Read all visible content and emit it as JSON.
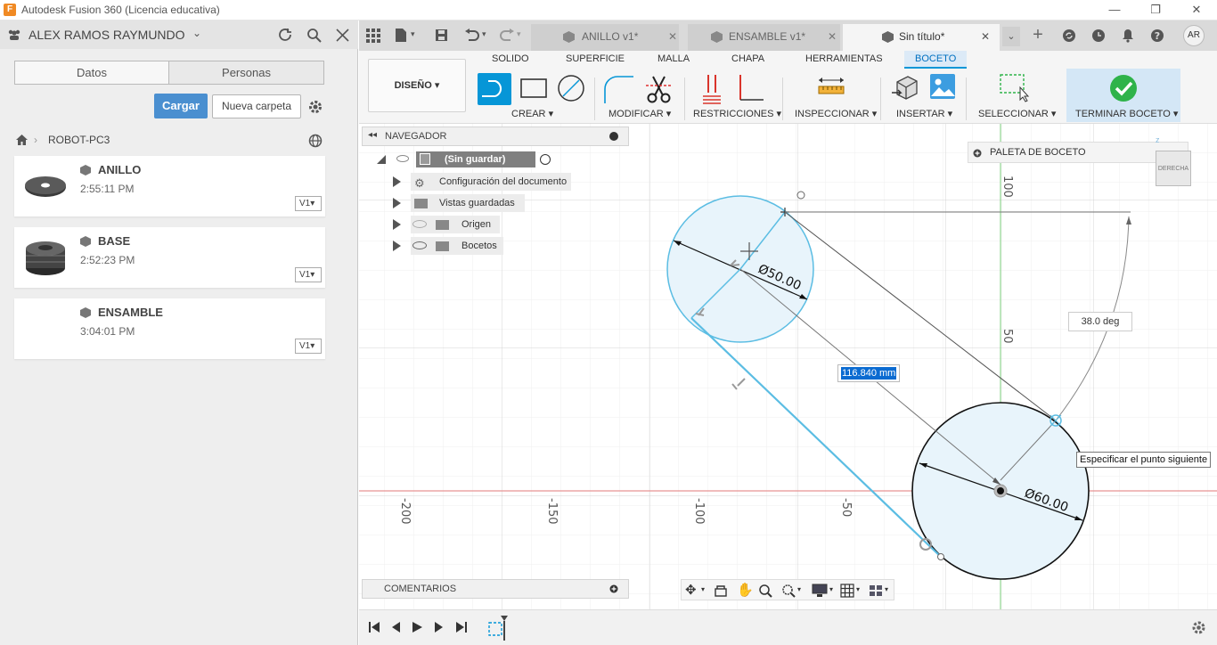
{
  "window": {
    "title": "Autodesk Fusion 360 (Licencia educativa)",
    "app_icon_letter": "F"
  },
  "left_panel": {
    "user": "ALEX RAMOS RAYMUNDO",
    "tabs": [
      "Datos",
      "Personas"
    ],
    "upload_button": "Cargar",
    "new_folder_button": "Nueva carpeta",
    "breadcrumb": "ROBOT-PC3",
    "files": [
      {
        "name": "ANILLO",
        "time": "2:55:11 PM",
        "version": "V1"
      },
      {
        "name": "BASE",
        "time": "2:52:23 PM",
        "version": "V1"
      },
      {
        "name": "ENSAMBLE",
        "time": "3:04:01 PM",
        "version": "V1"
      }
    ]
  },
  "doc_tabs": [
    {
      "label": "ANILLO v1*",
      "active": false
    },
    {
      "label": "ENSAMBLE v1*",
      "active": false
    },
    {
      "label": "Sin título*",
      "active": true
    }
  ],
  "user_initials": "AR",
  "ribbon": {
    "workspace": "DISEÑO",
    "tabs": [
      "SOLIDO",
      "SUPERFICIE",
      "MALLA",
      "CHAPA",
      "HERRAMIENTAS",
      "BOCETO"
    ],
    "active_tab": "BOCETO",
    "groups": [
      "CREAR",
      "MODIFICAR",
      "RESTRICCIONES",
      "INSPECCIONAR",
      "INSERTAR",
      "SELECCIONAR",
      "TERMINAR BOCETO"
    ]
  },
  "navigator": {
    "title": "NAVEGADOR",
    "root": "(Sin guardar)",
    "items": [
      "Configuración del documento",
      "Vistas guardadas",
      "Origen",
      "Bocetos"
    ]
  },
  "sketch_palette": "PALETA DE BOCETO",
  "viewcube_label": "DERECHA",
  "comments": "COMENTARIOS",
  "sketch": {
    "dim_circle1": "Ø50.00",
    "dim_circle2": "Ø60.00",
    "length_input": "116.840 mm",
    "angle": "38.0 deg",
    "tooltip": "Especificar el punto siguiente",
    "axis_labels_x": [
      "-200",
      "-150",
      "-100",
      "-50"
    ],
    "axis_labels_y": [
      "100",
      "50"
    ]
  },
  "colors": {
    "accent": "#0696d7",
    "sketch_blue": "#5bbde3",
    "finish_green": "#2fb34a"
  }
}
